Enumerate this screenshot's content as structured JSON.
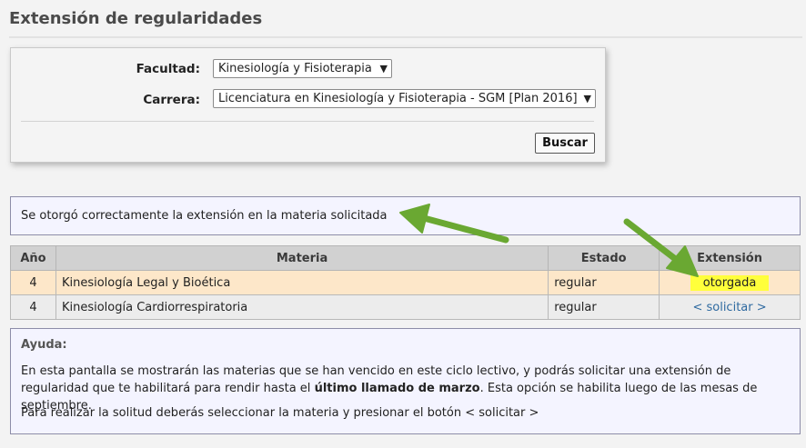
{
  "page": {
    "title": "Extensión de regularidades"
  },
  "filters": {
    "faculty_label": "Facultad:",
    "faculty_value": "Kinesiología y Fisioterapia",
    "career_label": "Carrera:",
    "career_value": "Licenciatura en Kinesiología y Fisioterapia - SGM [Plan 2016]",
    "search_label": "Buscar"
  },
  "message": {
    "text": "Se otorgó correctamente la extensión en la materia solicitada"
  },
  "table": {
    "headers": {
      "year": "Año",
      "subject": "Materia",
      "status": "Estado",
      "extension": "Extensión"
    },
    "rows": [
      {
        "year": "4",
        "subject": "Kinesiología Legal y Bioética",
        "status": "regular",
        "extension": "otorgada"
      },
      {
        "year": "4",
        "subject": "Kinesiología Cardiorrespiratoria",
        "status": "regular",
        "extension": "< solicitar >"
      }
    ]
  },
  "help": {
    "title": "Ayuda:",
    "p1_a": "En esta pantalla se mostrarán las materias que se han vencido en este ciclo lectivo, y podrás solicitar una extensión de regularidad que te habilitará para rendir hasta el ",
    "p1_bold": "último llamado de marzo",
    "p1_b": ". Esta opción se habilita luego de las mesas de septiembre.",
    "p2": "Para realizar la solitud deberás seleccionar la materia y presionar el botón < solicitar >"
  },
  "colors": {
    "highlight_row": "#fde7c9",
    "granted_badge": "#ffff3b",
    "annotation_arrow": "#6aa832",
    "link": "#2f6aa0"
  }
}
